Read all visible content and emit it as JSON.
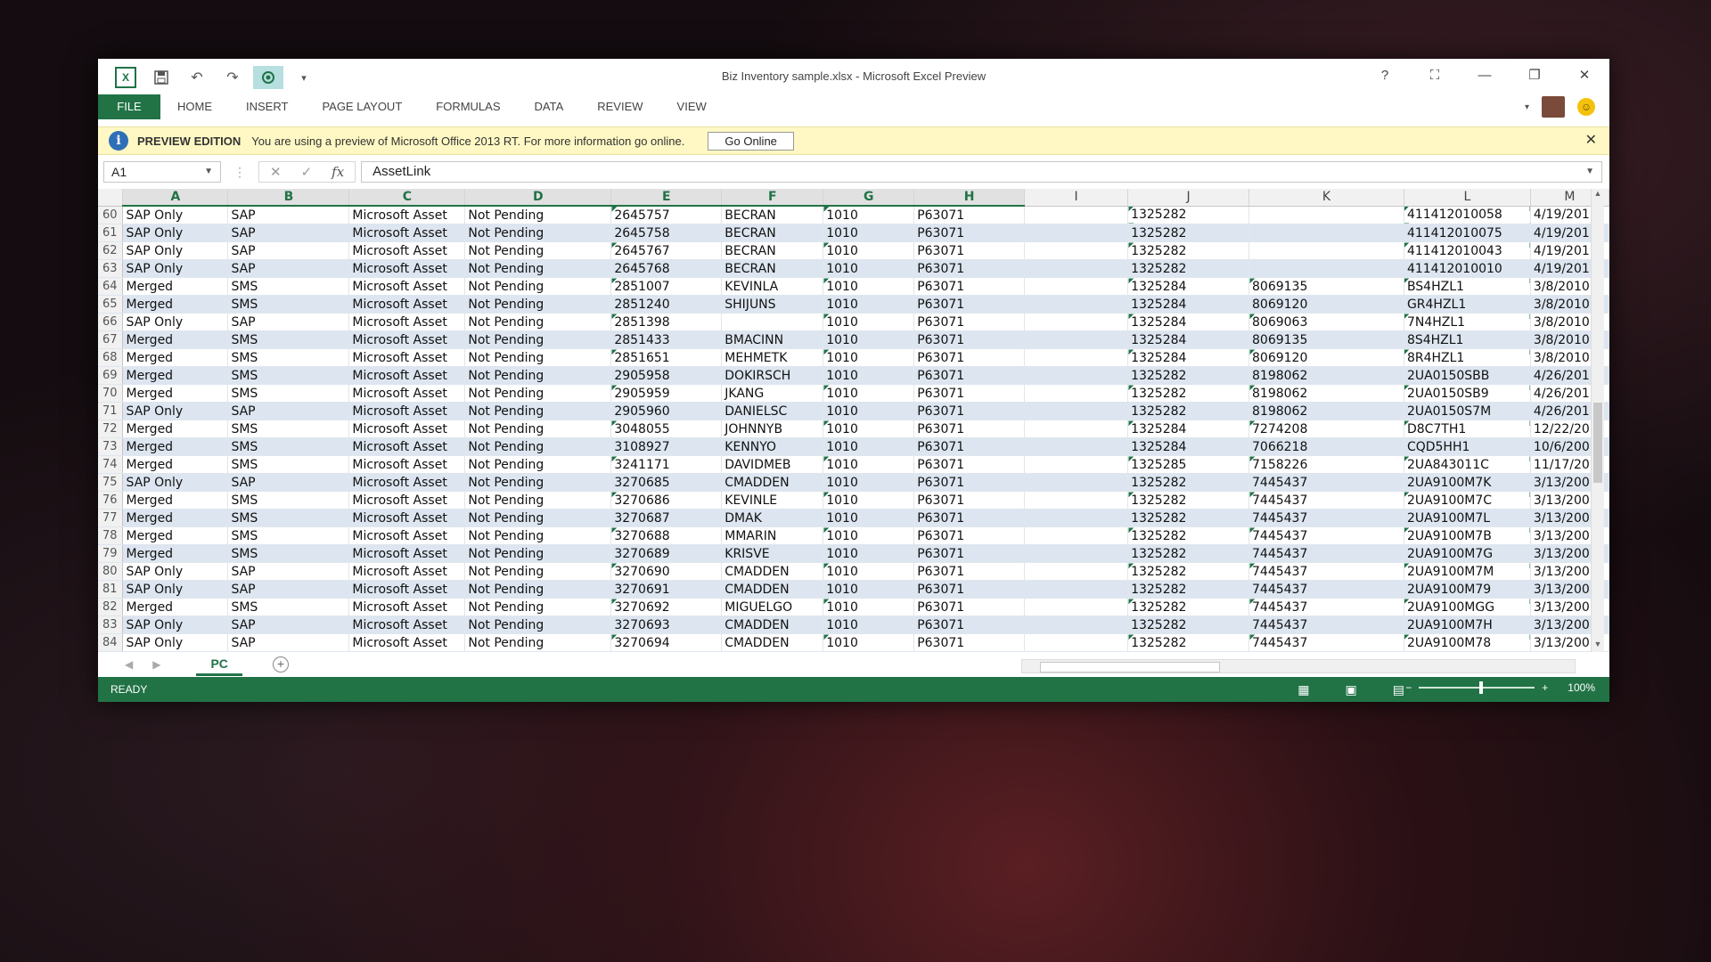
{
  "window": {
    "title": "Biz Inventory sample.xlsx - Microsoft Excel Preview",
    "controls": [
      "?",
      "⛶",
      "—",
      "❐",
      "✕"
    ]
  },
  "ribbon": {
    "tabs": [
      "FILE",
      "HOME",
      "INSERT",
      "PAGE LAYOUT",
      "FORMULAS",
      "DATA",
      "REVIEW",
      "VIEW"
    ]
  },
  "message_bar": {
    "title": "PREVIEW EDITION",
    "text": "You are using a preview of Microsoft Office 2013 RT. For more information go online.",
    "button": "Go Online"
  },
  "formula_bar": {
    "name_box": "A1",
    "formula": "AssetLink"
  },
  "sheet": {
    "columns": [
      "A",
      "B",
      "C",
      "D",
      "E",
      "F",
      "G",
      "H",
      "I",
      "J",
      "K",
      "L",
      "M"
    ],
    "rows": [
      {
        "num": "60",
        "cells": [
          "SAP Only",
          "SAP",
          "Microsoft Asset",
          "Not Pending",
          "2645757",
          "BECRAN",
          "1010",
          "P63071",
          "",
          "1325282",
          "",
          "411412010058",
          "4/19/201"
        ]
      },
      {
        "num": "61",
        "cells": [
          "SAP Only",
          "SAP",
          "Microsoft Asset",
          "Not Pending",
          "2645758",
          "BECRAN",
          "1010",
          "P63071",
          "",
          "1325282",
          "",
          "411412010075",
          "4/19/201"
        ]
      },
      {
        "num": "62",
        "cells": [
          "SAP Only",
          "SAP",
          "Microsoft Asset",
          "Not Pending",
          "2645767",
          "BECRAN",
          "1010",
          "P63071",
          "",
          "1325282",
          "",
          "411412010043",
          "4/19/201"
        ]
      },
      {
        "num": "63",
        "cells": [
          "SAP Only",
          "SAP",
          "Microsoft Asset",
          "Not Pending",
          "2645768",
          "BECRAN",
          "1010",
          "P63071",
          "",
          "1325282",
          "",
          "411412010010",
          "4/19/201"
        ]
      },
      {
        "num": "64",
        "cells": [
          "Merged",
          "SMS",
          "Microsoft Asset",
          "Not Pending",
          "2851007",
          "KEVINLA",
          "1010",
          "P63071",
          "",
          "1325284",
          "8069135",
          "BS4HZL1",
          "3/8/2010"
        ]
      },
      {
        "num": "65",
        "cells": [
          "Merged",
          "SMS",
          "Microsoft Asset",
          "Not Pending",
          "2851240",
          "SHIJUNS",
          "1010",
          "P63071",
          "",
          "1325284",
          "8069120",
          "GR4HZL1",
          "3/8/2010"
        ]
      },
      {
        "num": "66",
        "cells": [
          "SAP Only",
          "SAP",
          "Microsoft Asset",
          "Not Pending",
          "2851398",
          "",
          "1010",
          "P63071",
          "",
          "1325284",
          "8069063",
          "7N4HZL1",
          "3/8/2010"
        ]
      },
      {
        "num": "67",
        "cells": [
          "Merged",
          "SMS",
          "Microsoft Asset",
          "Not Pending",
          "2851433",
          "BMACINN",
          "1010",
          "P63071",
          "",
          "1325284",
          "8069135",
          "8S4HZL1",
          "3/8/2010"
        ]
      },
      {
        "num": "68",
        "cells": [
          "Merged",
          "SMS",
          "Microsoft Asset",
          "Not Pending",
          "2851651",
          "MEHMETK",
          "1010",
          "P63071",
          "",
          "1325284",
          "8069120",
          "8R4HZL1",
          "3/8/2010"
        ]
      },
      {
        "num": "69",
        "cells": [
          "Merged",
          "SMS",
          "Microsoft Asset",
          "Not Pending",
          "2905958",
          "DOKIRSCH",
          "1010",
          "P63071",
          "",
          "1325282",
          "8198062",
          "2UA0150SBB",
          "4/26/201"
        ]
      },
      {
        "num": "70",
        "cells": [
          "Merged",
          "SMS",
          "Microsoft Asset",
          "Not Pending",
          "2905959",
          "JKANG",
          "1010",
          "P63071",
          "",
          "1325282",
          "8198062",
          "2UA0150SB9",
          "4/26/201"
        ]
      },
      {
        "num": "71",
        "cells": [
          "SAP Only",
          "SAP",
          "Microsoft Asset",
          "Not Pending",
          "2905960",
          "DANIELSC",
          "1010",
          "P63071",
          "",
          "1325282",
          "8198062",
          "2UA0150S7M",
          "4/26/201"
        ]
      },
      {
        "num": "72",
        "cells": [
          "Merged",
          "SMS",
          "Microsoft Asset",
          "Not Pending",
          "3048055",
          "JOHNNYB",
          "1010",
          "P63071",
          "",
          "1325284",
          "7274208",
          "D8C7TH1",
          "12/22/20"
        ]
      },
      {
        "num": "73",
        "cells": [
          "Merged",
          "SMS",
          "Microsoft Asset",
          "Not Pending",
          "3108927",
          "KENNYO",
          "1010",
          "P63071",
          "",
          "1325284",
          "7066218",
          "CQD5HH1",
          "10/6/200"
        ]
      },
      {
        "num": "74",
        "cells": [
          "Merged",
          "SMS",
          "Microsoft Asset",
          "Not Pending",
          "3241171",
          "DAVIDMEB",
          "1010",
          "P63071",
          "",
          "1325285",
          "7158226",
          "2UA843011C",
          "11/17/20"
        ]
      },
      {
        "num": "75",
        "cells": [
          "SAP Only",
          "SAP",
          "Microsoft Asset",
          "Not Pending",
          "3270685",
          "CMADDEN",
          "1010",
          "P63071",
          "",
          "1325282",
          "7445437",
          "2UA9100M7K",
          "3/13/200"
        ]
      },
      {
        "num": "76",
        "cells": [
          "Merged",
          "SMS",
          "Microsoft Asset",
          "Not Pending",
          "3270686",
          "KEVINLE",
          "1010",
          "P63071",
          "",
          "1325282",
          "7445437",
          "2UA9100M7C",
          "3/13/200"
        ]
      },
      {
        "num": "77",
        "cells": [
          "Merged",
          "SMS",
          "Microsoft Asset",
          "Not Pending",
          "3270687",
          "DMAK",
          "1010",
          "P63071",
          "",
          "1325282",
          "7445437",
          "2UA9100M7L",
          "3/13/200"
        ]
      },
      {
        "num": "78",
        "cells": [
          "Merged",
          "SMS",
          "Microsoft Asset",
          "Not Pending",
          "3270688",
          "MMARIN",
          "1010",
          "P63071",
          "",
          "1325282",
          "7445437",
          "2UA9100M7B",
          "3/13/200"
        ]
      },
      {
        "num": "79",
        "cells": [
          "Merged",
          "SMS",
          "Microsoft Asset",
          "Not Pending",
          "3270689",
          "KRISVE",
          "1010",
          "P63071",
          "",
          "1325282",
          "7445437",
          "2UA9100M7G",
          "3/13/200"
        ]
      },
      {
        "num": "80",
        "cells": [
          "SAP Only",
          "SAP",
          "Microsoft Asset",
          "Not Pending",
          "3270690",
          "CMADDEN",
          "1010",
          "P63071",
          "",
          "1325282",
          "7445437",
          "2UA9100M7M",
          "3/13/200"
        ]
      },
      {
        "num": "81",
        "cells": [
          "SAP Only",
          "SAP",
          "Microsoft Asset",
          "Not Pending",
          "3270691",
          "CMADDEN",
          "1010",
          "P63071",
          "",
          "1325282",
          "7445437",
          "2UA9100M79",
          "3/13/200"
        ]
      },
      {
        "num": "82",
        "cells": [
          "Merged",
          "SMS",
          "Microsoft Asset",
          "Not Pending",
          "3270692",
          "MIGUELGO",
          "1010",
          "P63071",
          "",
          "1325282",
          "7445437",
          "2UA9100MGG",
          "3/13/200"
        ]
      },
      {
        "num": "83",
        "cells": [
          "SAP Only",
          "SAP",
          "Microsoft Asset",
          "Not Pending",
          "3270693",
          "CMADDEN",
          "1010",
          "P63071",
          "",
          "1325282",
          "7445437",
          "2UA9100M7H",
          "3/13/200"
        ]
      },
      {
        "num": "84",
        "cells": [
          "SAP Only",
          "SAP",
          "Microsoft Asset",
          "Not Pending",
          "3270694",
          "CMADDEN",
          "1010",
          "P63071",
          "",
          "1325282",
          "7445437",
          "2UA9100M78",
          "3/13/200"
        ]
      }
    ],
    "sheet_tabs": [
      "PC"
    ]
  },
  "status_bar": {
    "status": "READY",
    "zoom": "100%"
  },
  "icons": {
    "excel": "excel-logo-icon",
    "save": "save-icon",
    "undo": "undo-icon",
    "redo": "redo-icon",
    "touch": "touch-mode-icon",
    "info": "info-icon"
  },
  "colors": {
    "accent": "#217346",
    "band": "#dde6f0",
    "message_bar": "#fff8c4"
  }
}
